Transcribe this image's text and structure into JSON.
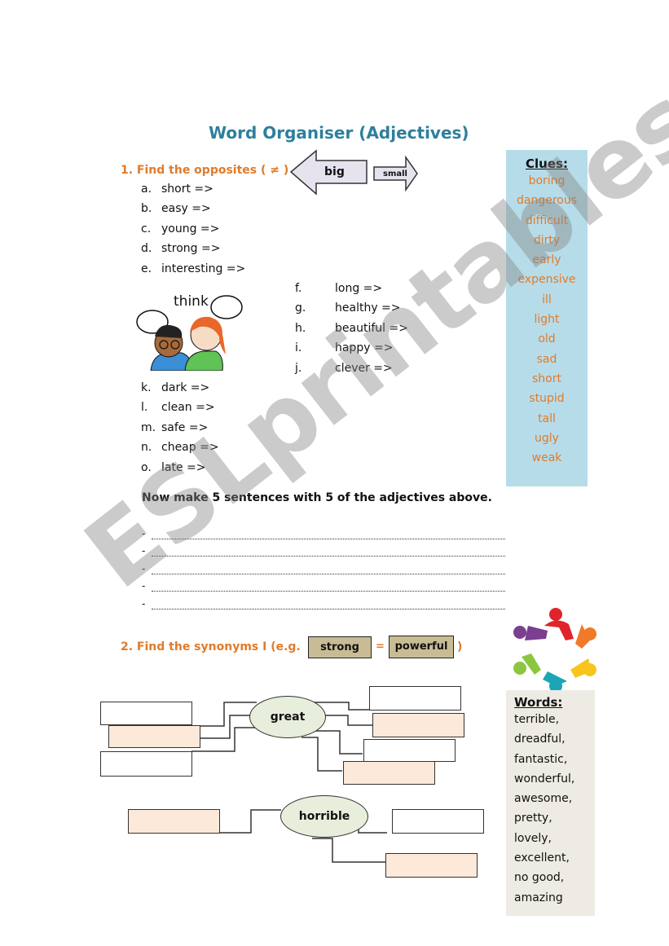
{
  "title": "Word Organiser (Adjectives)",
  "section1": {
    "heading": "1. Find the opposites ( ≠ )",
    "example": {
      "left": "big",
      "right": "small"
    },
    "items_a_e": [
      {
        "letter": "a.",
        "word": "short =>"
      },
      {
        "letter": "b.",
        "word": "easy =>"
      },
      {
        "letter": "c.",
        "word": "young =>"
      },
      {
        "letter": "d.",
        "word": "strong =>"
      },
      {
        "letter": "e.",
        "word": "interesting =>"
      }
    ],
    "items_f_j": [
      {
        "letter": "f.",
        "word": "long =>"
      },
      {
        "letter": "g.",
        "word": "healthy =>"
      },
      {
        "letter": "h.",
        "word": "beautiful =>"
      },
      {
        "letter": "i.",
        "word": "happy =>"
      },
      {
        "letter": "j.",
        "word": "clever =>"
      }
    ],
    "items_k_o": [
      {
        "letter": "k.",
        "word": "dark =>"
      },
      {
        "letter": "l.",
        "word": "clean =>"
      },
      {
        "letter": "m.",
        "word": "safe =>"
      },
      {
        "letter": "n.",
        "word": "cheap =>"
      },
      {
        "letter": "o.",
        "word": "late =>"
      }
    ],
    "think_image_label": "think",
    "instruction": "Now make 5 sentences with 5 of the adjectives above.",
    "sentence_lines": 5
  },
  "clues": {
    "title": "Clues:",
    "words": [
      "boring",
      "dangerous",
      "difficult",
      "dirty",
      "early",
      "expensive",
      "ill",
      "light",
      "old",
      "sad",
      "short",
      "stupid",
      "tall",
      "ugly",
      "weak"
    ]
  },
  "section2": {
    "heading": "2. Find the synonyms I (e.g.",
    "example": {
      "left": "strong",
      "equals": "=",
      "right": "powerful",
      "close": ")"
    },
    "hub1": "great",
    "hub2": "horrible"
  },
  "words_box": {
    "title": "Words:",
    "words": [
      "terrible,",
      "dreadful,",
      "fantastic,",
      "wonderful,",
      "awesome,",
      "pretty,",
      "lovely,",
      "excellent,",
      "no good,",
      "amazing"
    ]
  },
  "watermark": "ESLprintables.com",
  "colors": {
    "title": "#2e7f9c",
    "accent_orange": "#e07b2a",
    "clues_bg": "#b7dce9",
    "words_bg": "#edebe3",
    "peach": "#fde9d9",
    "example_box": "#c9bc95"
  }
}
